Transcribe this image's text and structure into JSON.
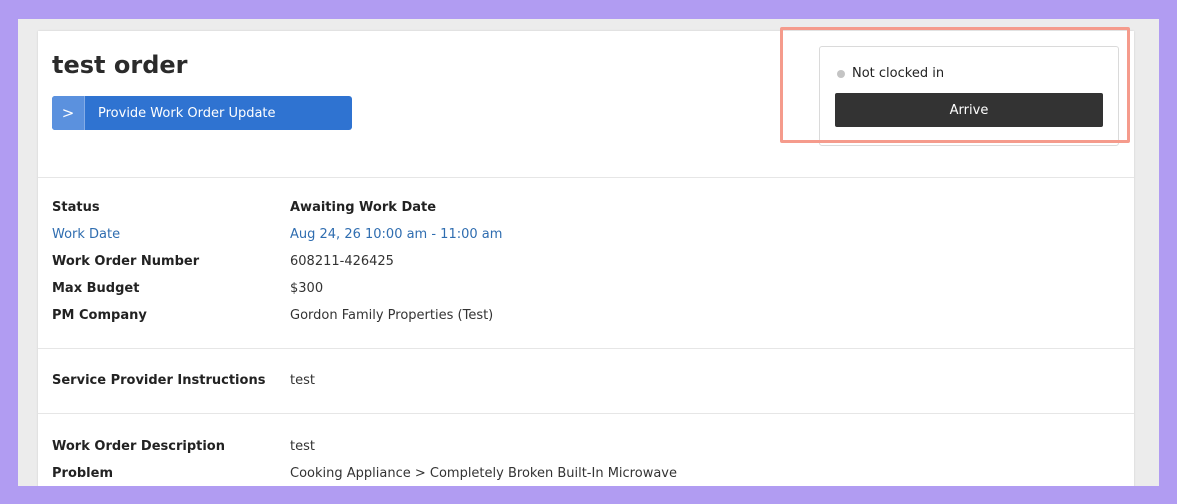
{
  "order": {
    "title": "test order",
    "update_button_label": "Provide Work Order Update",
    "chevron_glyph": ">"
  },
  "clock": {
    "status_text": "Not clocked in",
    "arrive_label": "Arrive"
  },
  "details": {
    "status": {
      "label": "Status",
      "value": "Awaiting Work Date"
    },
    "work_date": {
      "label": "Work Date",
      "value": "Aug 24, 26 10:00 am - 11:00 am"
    },
    "work_order_number": {
      "label": "Work Order Number",
      "value": "608211-426425"
    },
    "max_budget": {
      "label": "Max Budget",
      "value": "$300"
    },
    "pm_company": {
      "label": "PM Company",
      "value": "Gordon Family Properties (Test)"
    }
  },
  "instructions": {
    "label": "Service Provider Instructions",
    "value": "test"
  },
  "description": {
    "work_order_description": {
      "label": "Work Order Description",
      "value": "test"
    },
    "problem": {
      "label": "Problem",
      "value": "Cooking Appliance > Completely Broken Built-In Microwave"
    }
  },
  "colors": {
    "page_background": "#b19cf2",
    "primary_button": "#2f73d1",
    "arrive_button": "#333333",
    "link_text": "#2f6db0",
    "highlight_border": "#f59b8c"
  }
}
